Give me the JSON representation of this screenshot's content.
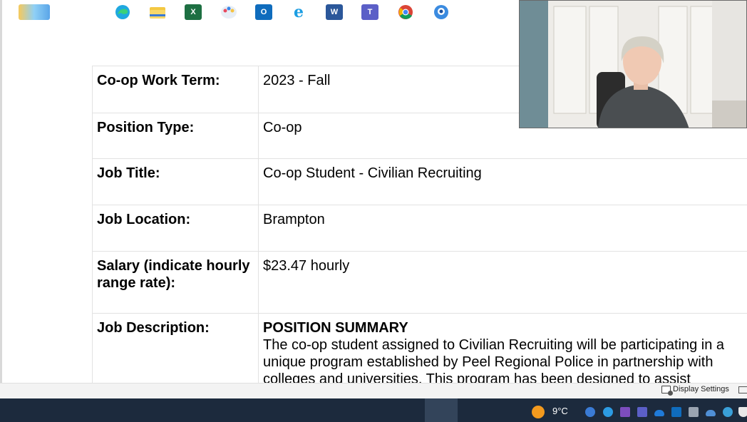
{
  "document": {
    "rows": [
      {
        "label": "Co-op Work Term:",
        "value": "2023 - Fall"
      },
      {
        "label": "Position Type:",
        "value": "Co-op"
      },
      {
        "label": "Job Title:",
        "value": "Co-op Student - Civilian Recruiting"
      },
      {
        "label": "Job Location:",
        "value": "Brampton"
      },
      {
        "label": "Salary (indicate hourly range rate):",
        "value": "$23.47 hourly"
      }
    ],
    "description": {
      "label": "Job Description:",
      "heading": "POSITION SUMMARY",
      "text": "The co-op student assigned to Civilian Recruiting will be participating in a unique program established by Peel Regional Police in partnership with colleges and universities. This program has been designed to assist"
    }
  },
  "status_bar": {
    "display_settings": "Display Settings"
  },
  "taskbar": {
    "weather_temp": "9°C",
    "apps": [
      {
        "name": "widgets-icon"
      },
      {
        "name": "task-view-icon"
      },
      {
        "name": "edge-icon"
      },
      {
        "name": "file-explorer-icon"
      },
      {
        "name": "excel-icon",
        "glyph": "X"
      },
      {
        "name": "paint-icon"
      },
      {
        "name": "outlook-icon",
        "glyph": "O"
      },
      {
        "name": "internet-explorer-icon",
        "glyph": "e"
      },
      {
        "name": "word-icon",
        "glyph": "W"
      },
      {
        "name": "teams-icon",
        "glyph": "T"
      },
      {
        "name": "chrome-icon"
      },
      {
        "name": "webcam-app-icon"
      }
    ],
    "colors": {
      "taskbar_bg": "#1c2a3d",
      "excel": "#1d6f42",
      "word": "#2b579a",
      "outlook": "#0f6cbd",
      "teams": "#5b5fc7"
    }
  }
}
